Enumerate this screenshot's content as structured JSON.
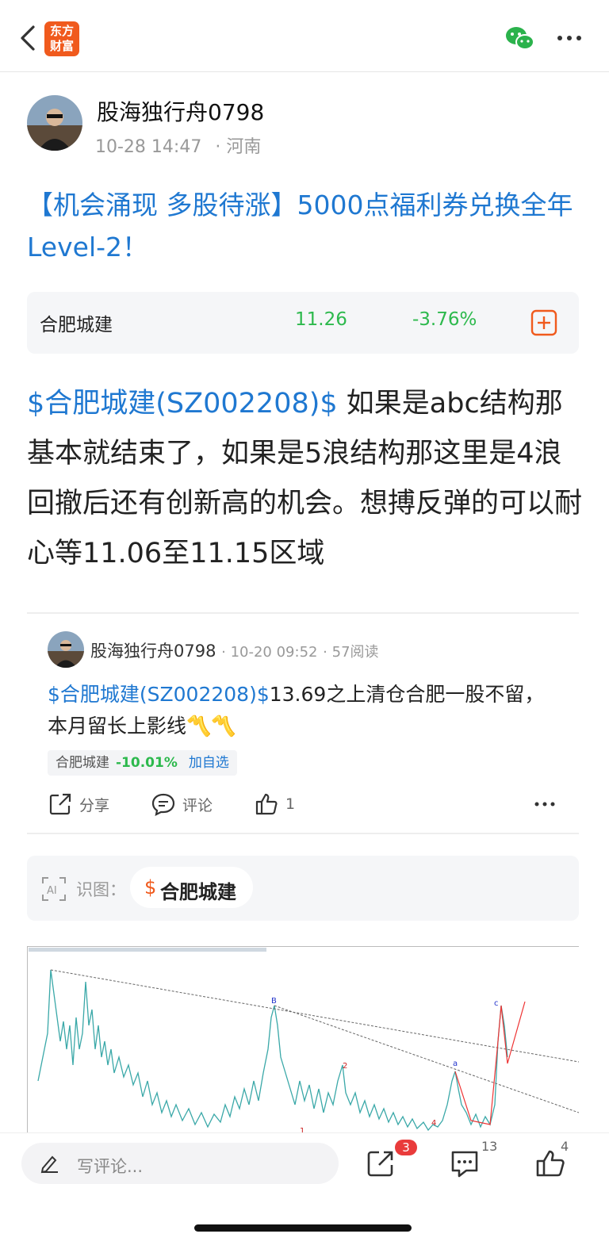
{
  "header": {
    "logo_line1": "东方",
    "logo_line2": "财富"
  },
  "author": {
    "name": "股海独行舟0798",
    "time": "10-28 14:47",
    "location": "· 河南"
  },
  "title": "【机会涌现 多股待涨】5000点福利券兑换全年Level-2！",
  "stock_card": {
    "name": "合肥城建",
    "price": "11.26",
    "change": "-3.76%"
  },
  "body": {
    "link": "$合肥城建(SZ002208)$",
    "text": "  如果是abc结构那基本就结束了，如果是5浪结构那这里是4浪回撤后还有创新高的机会。想搏反弹的可以耐心等11.06至11.15区域"
  },
  "quoted": {
    "author": "股海独行舟0798",
    "time": "· 10-20 09:52",
    "reads": "· 57阅读",
    "link": "$合肥城建(SZ002208)$",
    "text": "13.69之上清仓合肥一股不留，本月留长上影线〽️〽️",
    "tag_name": "合肥城建",
    "tag_change": "-10.01%",
    "tag_action": "加自选",
    "share_label": "分享",
    "comment_label": "评论",
    "like_count": "1"
  },
  "ai_card": {
    "label": "识图：",
    "symbol": "$",
    "stock": "合肥城建"
  },
  "chart_data": {
    "type": "line",
    "annotations": [
      "B",
      "2",
      "a",
      "c",
      "4",
      "1"
    ]
  },
  "bottom": {
    "placeholder": "写评论...",
    "share_badge": "3",
    "comment_count": "13",
    "like_count": "4"
  },
  "colors": {
    "brand": "#f05a1d",
    "link": "#1f78d1",
    "down": "#2db94d",
    "chart_line": "#3aa8a8"
  }
}
